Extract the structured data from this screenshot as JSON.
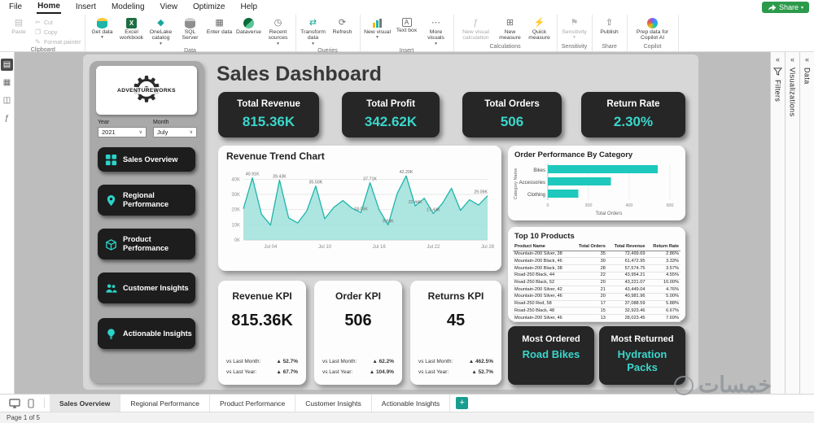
{
  "app": {
    "menu": [
      "File",
      "Home",
      "Insert",
      "Modeling",
      "View",
      "Optimize",
      "Help"
    ],
    "active_menu": "Home",
    "share_label": "Share"
  },
  "ribbon": {
    "groups": [
      {
        "label": "Clipboard"
      },
      {
        "label": "Data"
      },
      {
        "label": "Queries"
      },
      {
        "label": "Insert"
      },
      {
        "label": "Calculations"
      },
      {
        "label": "Sensitivity"
      },
      {
        "label": "Share"
      },
      {
        "label": "Copilot"
      }
    ],
    "buttons": {
      "paste": "Paste",
      "cut": "Cut",
      "copy": "Copy",
      "format_painter": "Format painter",
      "get_data": "Get data",
      "excel": "Excel workbook",
      "onelake": "OneLake catalog",
      "sql": "SQL Server",
      "enter_data": "Enter data",
      "dataverse": "Dataverse",
      "recent": "Recent sources",
      "transform": "Transform data",
      "refresh": "Refresh",
      "new_visual": "New visual",
      "text_box": "Text box",
      "more_visuals": "More visuals",
      "new_visual_calc": "New visual calculation",
      "new_measure": "New measure",
      "quick_measure": "Quick measure",
      "sensitivity": "Sensitivity",
      "publish": "Publish",
      "copilot_prep": "Prep data for Copilot AI"
    }
  },
  "panes": {
    "filters": "Filters",
    "visualizations": "Visualizations",
    "data": "Data"
  },
  "dashboard": {
    "logo_text": "ADVENTUREWORKS",
    "slicers": {
      "year_label": "Year",
      "year_value": "2021",
      "month_label": "Month",
      "month_value": "July"
    },
    "nav": [
      {
        "label": "Sales Overview"
      },
      {
        "label": "Regional Performance"
      },
      {
        "label": "Product Performance"
      },
      {
        "label": "Customer Insights"
      },
      {
        "label": "Actionable Insights"
      }
    ],
    "title": "Sales Dashboard",
    "kpi_cards": [
      {
        "title": "Total Revenue",
        "value": "815.36K"
      },
      {
        "title": "Total Profit",
        "value": "342.62K"
      },
      {
        "title": "Total Orders",
        "value": "506"
      },
      {
        "title": "Return Rate",
        "value": "2.30%"
      }
    ],
    "kpi_panels": [
      {
        "title": "Revenue KPI",
        "value": "815.36K",
        "rows": [
          {
            "label": "vs Last Month:",
            "value": "▲ 52.7%"
          },
          {
            "label": "vs Last Year:",
            "value": "▲ 67.7%"
          }
        ]
      },
      {
        "title": "Order KPI",
        "value": "506",
        "rows": [
          {
            "label": "vs Last Month:",
            "value": "▲ 62.2%"
          },
          {
            "label": "vs Last Year:",
            "value": "▲ 104.9%"
          }
        ]
      },
      {
        "title": "Returns KPI",
        "value": "45",
        "rows": [
          {
            "label": "vs Last Month:",
            "value": "▲ 462.5%"
          },
          {
            "label": "vs Last Year:",
            "value": "▲ 52.7%"
          }
        ]
      }
    ],
    "most_ordered": {
      "title": "Most Ordered",
      "value": "Road Bikes"
    },
    "most_returned": {
      "title": "Most Returned",
      "value": "Hydration Packs"
    },
    "top_products": {
      "title": "Top 10 Products",
      "headers": [
        "Product Name",
        "Total Orders",
        "Total Revenue",
        "Return Rate"
      ],
      "rows": [
        [
          "Mountain-200 Silver, 38",
          "35",
          "72,499.69",
          "2.86%"
        ],
        [
          "Mountain-200 Black, 46",
          "30",
          "61,472.95",
          "3.33%"
        ],
        [
          "Mountain-200 Black, 38",
          "28",
          "57,574.75",
          "3.57%"
        ],
        [
          "Road-250 Black, 44",
          "22",
          "43,954.21",
          "4.55%"
        ],
        [
          "Road-250 Black, 52",
          "20",
          "43,221.07",
          "10.00%"
        ],
        [
          "Mountain-200 Silver, 42",
          "21",
          "43,449.04",
          "4.76%"
        ],
        [
          "Mountain-200 Silver, 46",
          "20",
          "40,981.96",
          "5.00%"
        ],
        [
          "Road-250 Red, 58",
          "17",
          "37,088.59",
          "5.88%"
        ],
        [
          "Road-250 Black, 48",
          "15",
          "32,923.46",
          "6.67%"
        ],
        [
          "Mountain-200 Silver, 46",
          "13",
          "28,023.45",
          "7.69%"
        ]
      ]
    }
  },
  "chart_data": [
    {
      "id": "revenue_trend",
      "type": "area",
      "title": "Revenue Trend Chart",
      "x": [
        "Jul 01",
        "Jul 02",
        "Jul 03",
        "Jul 04",
        "Jul 05",
        "Jul 06",
        "Jul 07",
        "Jul 08",
        "Jul 09",
        "Jul 10",
        "Jul 11",
        "Jul 12",
        "Jul 13",
        "Jul 14",
        "Jul 15",
        "Jul 16",
        "Jul 17",
        "Jul 18",
        "Jul 19",
        "Jul 20",
        "Jul 21",
        "Jul 22",
        "Jul 23",
        "Jul 24",
        "Jul 25",
        "Jul 26",
        "Jul 27",
        "Jul 28"
      ],
      "values": [
        20.5,
        40.91,
        17.0,
        9.8,
        39.43,
        14.5,
        11.2,
        19.0,
        35.5,
        14.0,
        21.5,
        26.0,
        21.0,
        18.05,
        37.71,
        20.0,
        9.93,
        30.5,
        42.2,
        22.44,
        27.5,
        17.43,
        24.0,
        34.0,
        19.5,
        26.5,
        23.0,
        29.09
      ],
      "point_labels": [
        {
          "index": 1,
          "text": "40.91K"
        },
        {
          "index": 4,
          "text": "39.43K"
        },
        {
          "index": 8,
          "text": "35.50K"
        },
        {
          "index": 13,
          "text": "18.05K"
        },
        {
          "index": 14,
          "text": "37.71K"
        },
        {
          "index": 16,
          "text": "9.93K"
        },
        {
          "index": 18,
          "text": "42.20K"
        },
        {
          "index": 19,
          "text": "22.44K"
        },
        {
          "index": 21,
          "text": "17.43K"
        },
        {
          "index": 27,
          "text": "29.09K"
        }
      ],
      "x_tick_indices": [
        3,
        9,
        15,
        21,
        27
      ],
      "y_ticks": [
        {
          "label": "0K",
          "value": 0
        },
        {
          "label": "10K",
          "value": 10
        },
        {
          "label": "20K",
          "value": 20
        },
        {
          "label": "30K",
          "value": 30
        },
        {
          "label": "40K",
          "value": 40
        }
      ],
      "ylim": [
        0,
        45
      ],
      "grid": true,
      "line_color": "#1FB5AA",
      "fill_color": "#9FE0DB"
    },
    {
      "id": "orders_by_category",
      "type": "bar",
      "orientation": "horizontal",
      "title": "Order Performance By Category",
      "categories": [
        "Bikes",
        "Accessories",
        "Clothing"
      ],
      "values": [
        540,
        310,
        150
      ],
      "xlabel": "Total Orders",
      "ylabel": "Category Name",
      "xlim": [
        0,
        600
      ],
      "x_ticks": [
        0,
        200,
        400,
        600
      ],
      "bar_color": "#1EC8BD"
    }
  ],
  "footer": {
    "tabs": [
      "Sales Overview",
      "Regional Performance",
      "Product Performance",
      "Customer Insights",
      "Actionable Insights"
    ],
    "active_tab": "Sales Overview",
    "add_tab": "+",
    "page_indicator": "Page 1 of 5"
  },
  "watermark": "خمسات",
  "colors": {
    "accent": "#1EC8BD",
    "dark_card": "#262626",
    "value_teal": "#3BD6CB",
    "share_green": "#2C9A4B"
  }
}
